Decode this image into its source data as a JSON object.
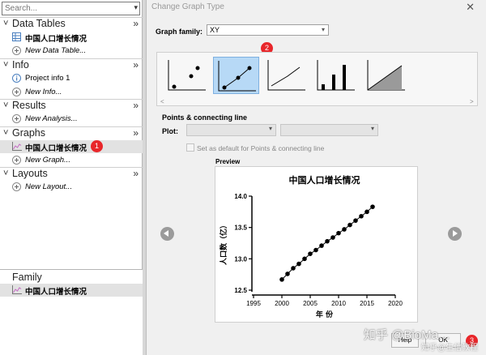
{
  "navigator": {
    "search_placeholder": "Search...",
    "sections": [
      {
        "title": "Data Tables",
        "items": [
          {
            "label": "中国人口增长情况",
            "kind": "table"
          },
          {
            "label": "New Data Table...",
            "kind": "new"
          }
        ]
      },
      {
        "title": "Info",
        "items": [
          {
            "label": "Project info 1",
            "kind": "info"
          },
          {
            "label": "New Info...",
            "kind": "new"
          }
        ]
      },
      {
        "title": "Results",
        "items": [
          {
            "label": "New Analysis...",
            "kind": "new"
          }
        ]
      },
      {
        "title": "Graphs",
        "items": [
          {
            "label": "中国人口增长情况",
            "kind": "graph",
            "selected": true,
            "badge": "1"
          },
          {
            "label": "New Graph...",
            "kind": "new"
          }
        ]
      },
      {
        "title": "Layouts",
        "items": [
          {
            "label": "New Layout...",
            "kind": "new"
          }
        ]
      }
    ],
    "family": {
      "title": "Family",
      "items": [
        {
          "label": "中国人口增长情况"
        }
      ]
    }
  },
  "dialog": {
    "title": "Change Graph Type",
    "graph_family_label": "Graph family:",
    "graph_family_value": "XY",
    "gallery_badge": "2",
    "gallery": [
      {
        "name": "points-only",
        "selected": false
      },
      {
        "name": "points-connecting-line",
        "selected": true
      },
      {
        "name": "line-only",
        "selected": false
      },
      {
        "name": "spikes",
        "selected": false
      },
      {
        "name": "area-fill",
        "selected": false
      }
    ],
    "selection_label": "Points & connecting line",
    "plot_label": "Plot:",
    "set_default_label": "Set as default for Points & connecting line",
    "preview_label": "Preview",
    "help_label": "Help",
    "ok_label": "OK",
    "ok_badge": "3",
    "watermark": "知乎 @BioMa…",
    "watermark_sub": "知乎@生信教程"
  },
  "chart_data": {
    "type": "line",
    "title": "中国人口增长情况",
    "xlabel": "年 份",
    "ylabel": "人口数（亿）",
    "xlim": [
      1995,
      2020
    ],
    "ylim": [
      12.5,
      14.0
    ],
    "xticks": [
      1995,
      2000,
      2005,
      2010,
      2015,
      2020
    ],
    "yticks": [
      12.5,
      13.0,
      13.5,
      14.0
    ],
    "x": [
      2000,
      2001,
      2002,
      2003,
      2004,
      2005,
      2006,
      2007,
      2008,
      2009,
      2010,
      2011,
      2012,
      2013,
      2014,
      2015,
      2016
    ],
    "y": [
      12.67,
      12.76,
      12.85,
      12.92,
      13.0,
      13.08,
      13.14,
      13.21,
      13.28,
      13.34,
      13.41,
      13.47,
      13.54,
      13.61,
      13.68,
      13.75,
      13.83
    ],
    "marker": "circle",
    "color": "#000000"
  }
}
